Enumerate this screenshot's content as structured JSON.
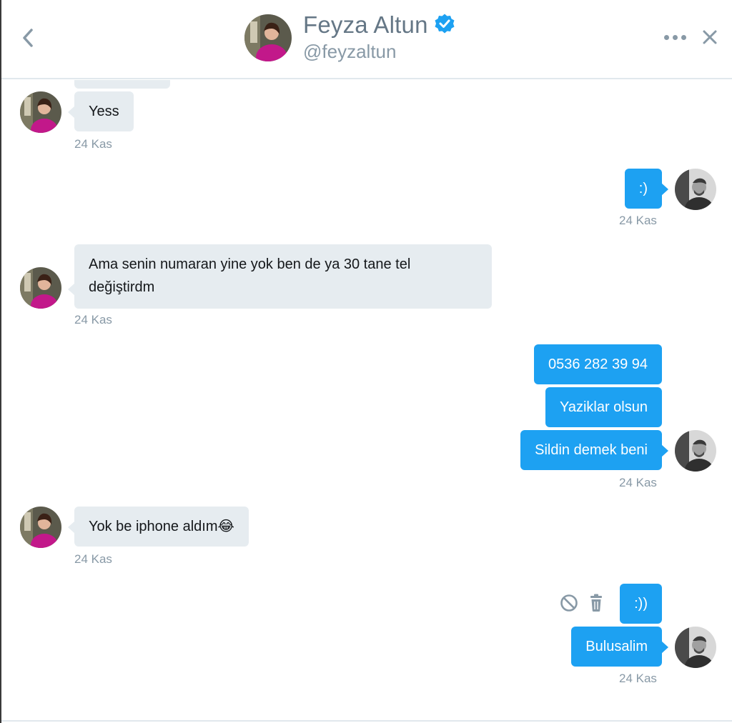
{
  "header": {
    "name": "Feyza Altun",
    "handle": "@feyzaltun",
    "verified": true
  },
  "colors": {
    "accent": "#1da1f2",
    "incoming_bubble": "#e6ecf0",
    "muted_text": "#8899a6"
  },
  "messages": [
    {
      "side": "in",
      "text": "Yess",
      "time": "24 Kas"
    },
    {
      "side": "out",
      "text": ":)",
      "time": "24 Kas"
    },
    {
      "side": "in",
      "text": "Ama senin numaran yine yok ben de ya 30 tane tel değiştirdm",
      "time": "24 Kas"
    },
    {
      "side": "out",
      "text": "0536 282 39 94"
    },
    {
      "side": "out",
      "text": "Yaziklar olsun"
    },
    {
      "side": "out",
      "text": "Sildin demek beni",
      "time": "24 Kas"
    },
    {
      "side": "in",
      "text": "Yok be iphone aldım😂",
      "time": "24 Kas"
    },
    {
      "side": "out",
      "text": ":))"
    },
    {
      "side": "out",
      "text": "Bulusalim",
      "time": "24 Kas"
    }
  ],
  "icons": {
    "back": "chevron-left-icon",
    "more": "more-dots-icon",
    "close": "close-icon",
    "verified": "verified-badge-icon",
    "report": "block-icon",
    "delete": "trash-icon"
  }
}
